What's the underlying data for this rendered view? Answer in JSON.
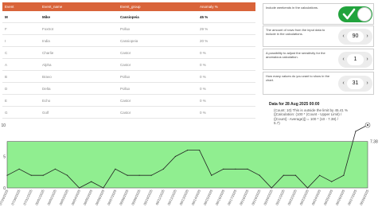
{
  "table": {
    "columns": [
      "Event",
      "Event_name",
      "Event_group",
      "Anomaly %"
    ],
    "rows": [
      [
        "M",
        "Mike",
        "Cassiopeia",
        "45 %"
      ],
      [
        "F",
        "Foxtrot",
        "Pollux",
        "29 %"
      ],
      [
        "I",
        "India",
        "Cassiopeia",
        "20 %"
      ],
      [
        "C",
        "Charlie",
        "Castor",
        "0 %"
      ],
      [
        "A",
        "Alpha",
        "Castor",
        "0 %"
      ],
      [
        "B",
        "Bravo",
        "Pollux",
        "0 %"
      ],
      [
        "D",
        "Delta",
        "Pollux",
        "0 %"
      ],
      [
        "E",
        "Echo",
        "Castor",
        "0 %"
      ],
      [
        "G",
        "Golf",
        "Castor",
        "0 %"
      ]
    ]
  },
  "settings": {
    "weekends_label": "Include weekends in the calculations.",
    "weekends_on": true,
    "rows_label": "The amount of rows from the input data to include in the calculations.",
    "rows_value": "90",
    "sensitivity_label": "A possibility to adjust the sensitivity for the anomalous calculation.",
    "sensitivity_value": "1",
    "days_label": "How many values do you want to show in the chart.",
    "days_value": "31",
    "arrow_left": "‹",
    "arrow_right": "›"
  },
  "tooltip": {
    "title": "Data for 28 Aug 2025 00:00",
    "line1": "(Count: 10)   This is outside the limit by 45.41 %",
    "line2": "([Calculation: (100 * (Count - Upper Limit) /",
    "line3": "([Count] - Average)]) = 100 * (10 - 7.38) /",
    "line4": "5.7)"
  },
  "colors": {
    "header": "#d9643a",
    "band": "#90ee90",
    "toggle": "#22a33d",
    "line": "#222222"
  },
  "chart_data": {
    "type": "line",
    "x": [
      "07/29/2025",
      "07/30/2025",
      "07/31/2025",
      "08/01/2025",
      "08/02/2025",
      "08/03/2025",
      "08/04/2025",
      "08/05/2025",
      "08/06/2025",
      "08/07/2025",
      "08/08/2025",
      "08/09/2025",
      "08/10/2025",
      "08/11/2025",
      "08/12/2025",
      "08/13/2025",
      "08/14/2025",
      "08/15/2025",
      "08/16/2025",
      "08/17/2025",
      "08/18/2025",
      "08/19/2025",
      "08/20/2025",
      "08/21/2025",
      "08/22/2025",
      "08/23/2025",
      "08/24/2025",
      "08/25/2025",
      "08/26/2025",
      "08/27/2025",
      "08/28/2025"
    ],
    "values": [
      2,
      3,
      2,
      2,
      3,
      2,
      0,
      1,
      0,
      3,
      2,
      2,
      2,
      3,
      5,
      6,
      6,
      2,
      3,
      3,
      3,
      2,
      0,
      2,
      2,
      0,
      2,
      1,
      2,
      9,
      10
    ],
    "band": {
      "low": 0,
      "high": 7.38
    },
    "upper_label": "7.38",
    "yticks": [
      "10",
      "5",
      "0"
    ],
    "ylim": [
      0,
      10
    ],
    "highlight_last": true
  }
}
